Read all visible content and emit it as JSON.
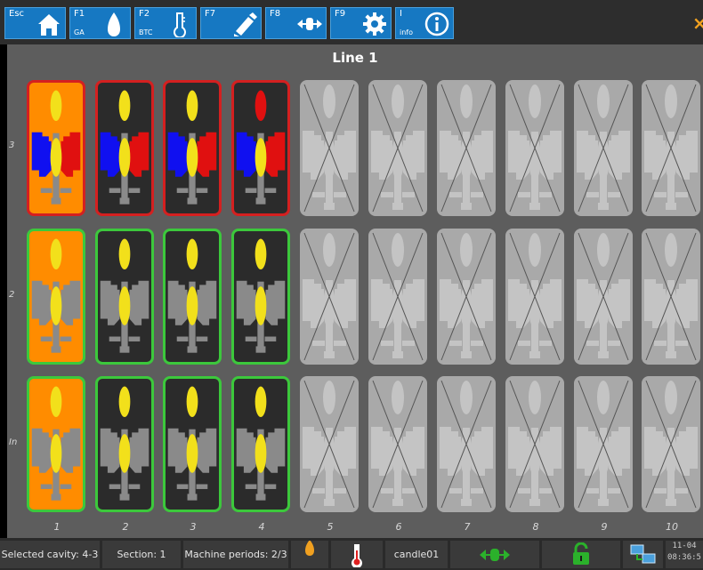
{
  "toolbar": {
    "buttons": [
      {
        "key": "Esc",
        "sub": "",
        "icon": "home-icon"
      },
      {
        "key": "F1",
        "sub": "GA",
        "icon": "drop-icon"
      },
      {
        "key": "F2",
        "sub": "BTC",
        "icon": "thermometer-icon"
      },
      {
        "key": "F7",
        "sub": "",
        "icon": "edit-icon"
      },
      {
        "key": "F8",
        "sub": "",
        "icon": "expand-horizontal-icon"
      },
      {
        "key": "F9",
        "sub": "",
        "icon": "gear-icon"
      },
      {
        "key": "I",
        "sub": "info",
        "icon": "info-icon"
      }
    ],
    "close_label": "×"
  },
  "grid": {
    "title": "Line 1",
    "row_labels": [
      "3",
      "2",
      "In"
    ],
    "col_labels": [
      "1",
      "2",
      "3",
      "4",
      "5",
      "6",
      "7",
      "8",
      "9",
      "10"
    ],
    "rows": [
      [
        "selected-red",
        "red",
        "red",
        "red-partial",
        "disabled",
        "disabled",
        "disabled",
        "disabled",
        "disabled",
        "disabled"
      ],
      [
        "selected-green",
        "green",
        "green",
        "green",
        "disabled",
        "disabled",
        "disabled",
        "disabled",
        "disabled",
        "disabled"
      ],
      [
        "selected-green",
        "green",
        "green",
        "green",
        "disabled",
        "disabled",
        "disabled",
        "disabled",
        "disabled",
        "disabled"
      ]
    ]
  },
  "colors": {
    "active_bg": "#2b2b2b",
    "selected_bg": "#ff8c00",
    "disabled_bg": "#a9a9a9",
    "flame": "#f2e01b",
    "red_border": "#d42020",
    "green_border": "#3cc83c",
    "blue_arm": "#1010f0",
    "red_arm": "#e01010",
    "gray_part": "#8a8a8a"
  },
  "status": {
    "selected_cavity": "Selected cavity: 4-3",
    "section": "Section: 1",
    "machine_periods": "Machine periods: 2/3",
    "product": "candle01",
    "date": "11-04",
    "time": "08:36:5",
    "icons": [
      "drop-icon",
      "thermometer-icon",
      "expand-horizontal-icon",
      "unlock-icon",
      "network-icon"
    ]
  }
}
